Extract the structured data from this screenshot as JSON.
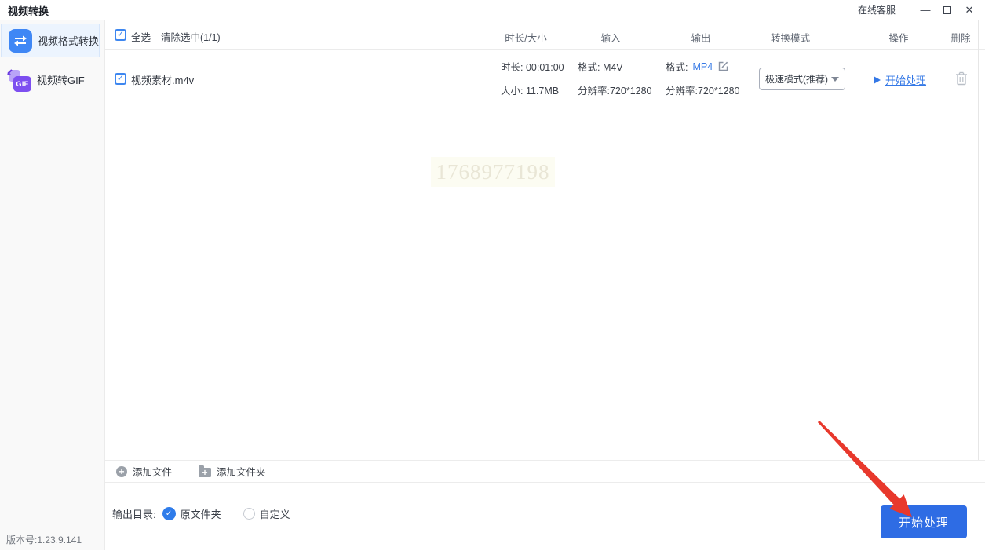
{
  "titlebar": {
    "app_title": "视频转换",
    "support_label": "在线客服",
    "minimize_glyph": "—",
    "close_glyph": "✕"
  },
  "sidebar": {
    "items": [
      {
        "label": "视频格式转换",
        "icon": "swap-icon",
        "active": true
      },
      {
        "label": "视频转GIF",
        "icon": "gif-icon",
        "active": false
      }
    ],
    "gif_badge_text": "GIF",
    "version": "版本号:1.23.9.141"
  },
  "list_header": {
    "select_all": "全选",
    "clear_selected": "清除选中",
    "selected_count": "(1/1)",
    "columns": [
      "时长/大小",
      "输入",
      "输出",
      "转换模式",
      "操作",
      "删除"
    ]
  },
  "file_row": {
    "name": "视频素材.m4v",
    "duration": "时长: 00:01:00",
    "size": "大小: 11.7MB",
    "input_format": "格式: M4V",
    "input_resolution": "分辨率:720*1280",
    "output_format_label": "格式:",
    "output_format_value": "MP4",
    "output_resolution": "分辨率:720*1280",
    "mode_selected": "极速模式(推荐)",
    "action_label": "开始处理"
  },
  "watermark_text": "1768977198",
  "toolbar": {
    "add_file": "添加文件",
    "add_folder": "添加文件夹"
  },
  "footer": {
    "output_dir_label": "输出目录:",
    "option_original": "原文件夹",
    "option_custom": "自定义",
    "original_selected": true,
    "start_button": "开始处理"
  },
  "colors": {
    "accent_blue": "#3478e6",
    "button_blue": "#2e6ce4",
    "sidebar_icon_blue": "#3f87f5",
    "gif_purple": "#7d4ff0",
    "arrow_red": "#e8382c",
    "selected_item_bg": "#ecf4fe"
  }
}
